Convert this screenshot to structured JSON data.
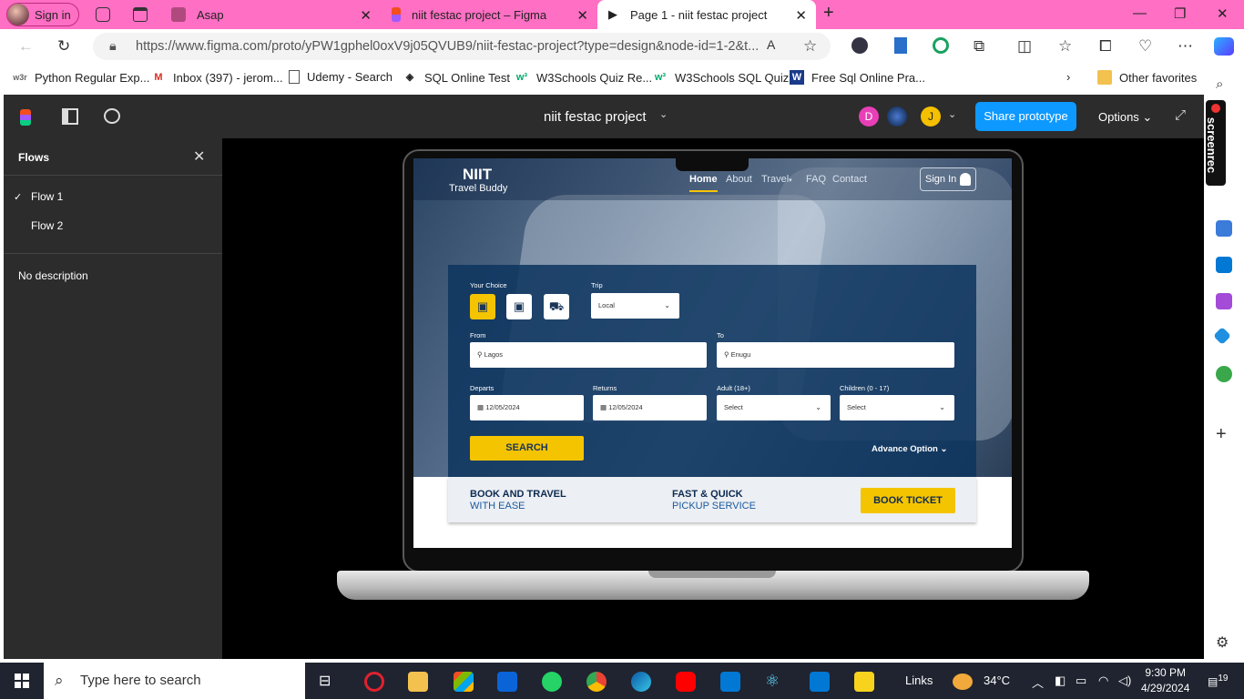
{
  "browser": {
    "profile_label": "Sign in",
    "tabs": [
      {
        "label": "Asap"
      },
      {
        "label": "niit festac project – Figma"
      },
      {
        "label": "Page 1 - niit festac project",
        "active": true
      }
    ],
    "url": "https://www.figma.com/proto/yPW1gphel0oxV9j05QVUB9/niit-festac-project?type=design&node-id=1-2&t..."
  },
  "bookmarks": [
    {
      "label": "Python Regular Exp..."
    },
    {
      "label": "Inbox (397) - jerom..."
    },
    {
      "label": "Udemy - Search"
    },
    {
      "label": "SQL Online Test"
    },
    {
      "label": "W3Schools Quiz Re..."
    },
    {
      "label": "W3Schools SQL Quiz"
    },
    {
      "label": "Free Sql Online Pra..."
    },
    {
      "label": "Other favorites"
    }
  ],
  "figma": {
    "file_title": "niit festac project",
    "avatars": [
      "D",
      "J"
    ],
    "share_label": "Share prototype",
    "options_label": "Options",
    "panel": {
      "title": "Flows",
      "flows": [
        "Flow 1",
        "Flow 2"
      ],
      "description": "No description"
    }
  },
  "site": {
    "logo_title": "NIIT",
    "logo_subtitle": "Travel Buddy",
    "nav": [
      "Home",
      "About",
      "Travel",
      "FAQ",
      "Contact"
    ],
    "sign_in": "Sign In",
    "form": {
      "your_choice_label": "Your Choice",
      "trip_label": "Trip",
      "trip_value": "Local",
      "from_label": "From",
      "from_value": "Lagos",
      "to_label": "To",
      "to_value": "Enugu",
      "departs_label": "Departs",
      "departs_value": "12/05/2024",
      "returns_label": "Returns",
      "returns_value": "12/05/2024",
      "adult_label": "Adult (18+)",
      "adult_value": "Select",
      "children_label": "Children (0 - 17)",
      "children_value": "Select",
      "search_label": "SEARCH",
      "advance_label": "Advance Option"
    },
    "strip": {
      "a_line1": "BOOK AND TRAVEL",
      "a_line2": "WITH EASE",
      "b_line1": "FAST & QUICK",
      "b_line2": "PICKUP SERVICE",
      "book_label": "BOOK TICKET"
    }
  },
  "screenrec_label": "screenrec",
  "taskbar": {
    "search_placeholder": "Type here to search",
    "links_label": "Links",
    "weather": "34°C",
    "time": "9:30 PM",
    "date": "4/29/2024",
    "notif_count": "19"
  }
}
